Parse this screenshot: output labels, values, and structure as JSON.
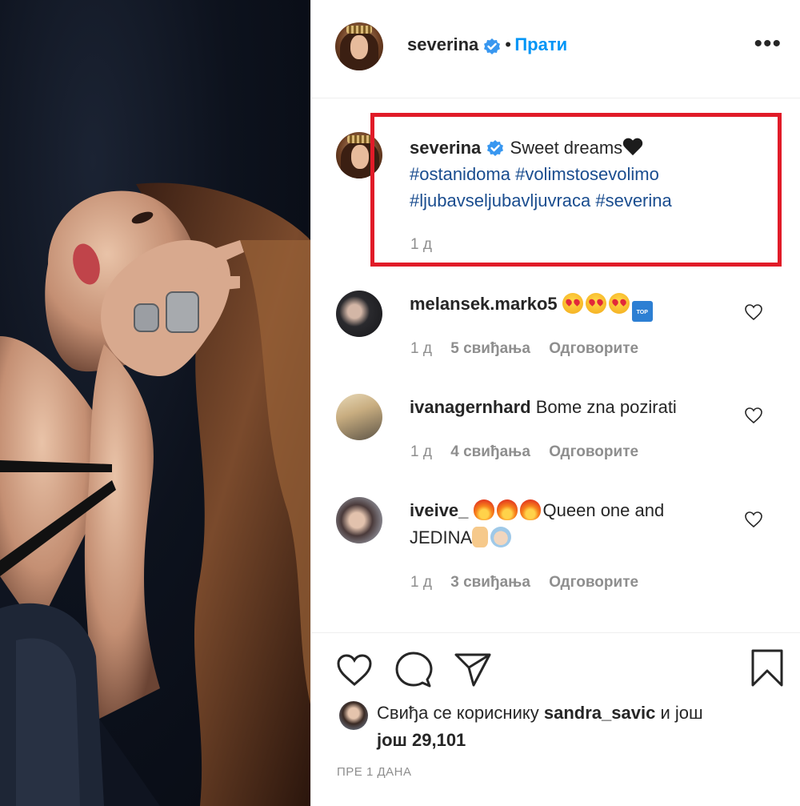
{
  "post": {
    "author": "severina",
    "follow_label": "Прати",
    "dot": "•",
    "more_label": "•••"
  },
  "caption": {
    "author": "severina",
    "text": "Sweet dreams",
    "hashtags_line1": "#ostanidoma #volimstosevolimo",
    "hashtags_line2": "#ljubavseljubavljuvraca #severina",
    "age": "1 д"
  },
  "comments": [
    {
      "user": "melansek.marko5",
      "text": "",
      "emoji": [
        "love",
        "love",
        "love",
        "top"
      ],
      "age": "1 д",
      "likes": "5 свиђања",
      "reply": "Одговорите"
    },
    {
      "user": "ivanagernhard",
      "text": "Bome zna pozirati",
      "age": "1 д",
      "likes": "4 свиђања",
      "reply": "Одговорите"
    },
    {
      "user": "iveive_",
      "text_line1": "Queen one and",
      "text_line2": "JEDINA",
      "age": "1 д",
      "likes": "3 свиђања",
      "reply": "Одговорите"
    }
  ],
  "likes": {
    "prefix": "Свиђа се кориснику",
    "user": "sandra_savic",
    "connector": "и још",
    "count": "још 29,101"
  },
  "timestamp": "ПРЕ 1 ДАНА",
  "colors": {
    "link": "#0095f6",
    "hashtag": "#1a4d8f",
    "muted": "#8e8e8e",
    "highlight": "#e11b28",
    "verified": "#3897f0"
  }
}
